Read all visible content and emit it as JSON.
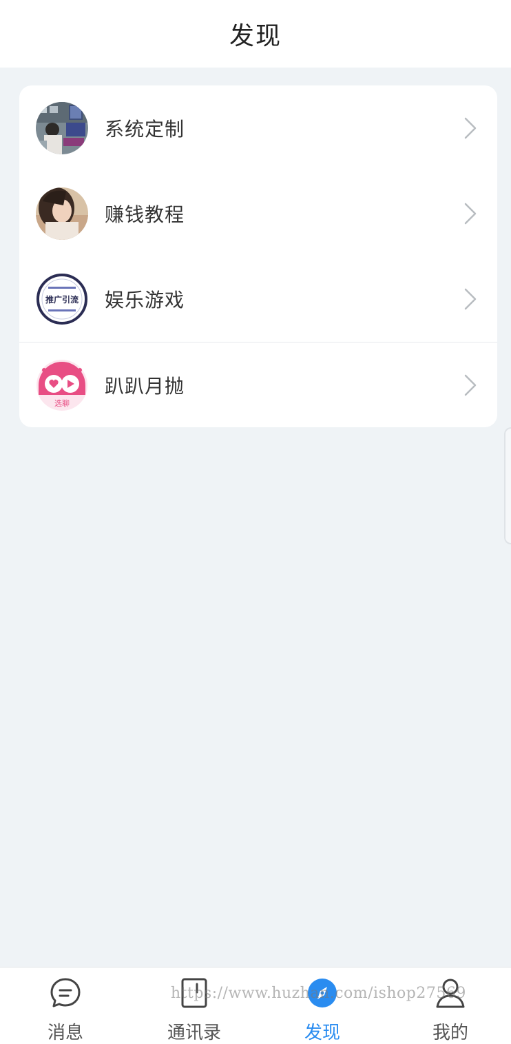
{
  "header": {
    "title": "发现"
  },
  "menu": {
    "items": [
      {
        "label": "系统定制",
        "icon": "system-custom-avatar"
      },
      {
        "label": "赚钱教程",
        "icon": "earn-money-avatar"
      },
      {
        "label": "娱乐游戏",
        "icon": "promo-badge-avatar",
        "badge_text": "推广引流"
      },
      {
        "label": "趴趴月抛",
        "icon": "chat-app-logo",
        "logo_text": "选聊"
      }
    ]
  },
  "tabbar": {
    "tabs": [
      {
        "label": "消息",
        "icon": "message-bubble-icon"
      },
      {
        "label": "通讯录",
        "icon": "contacts-icon"
      },
      {
        "label": "发现",
        "icon": "compass-icon",
        "active": true
      },
      {
        "label": "我的",
        "icon": "user-icon"
      }
    ]
  },
  "watermark": "https://www.huzhan.com/ishop27569",
  "colors": {
    "accent": "#2a8cf0",
    "background": "#eff3f6",
    "logo_pink": "#e84e84"
  }
}
